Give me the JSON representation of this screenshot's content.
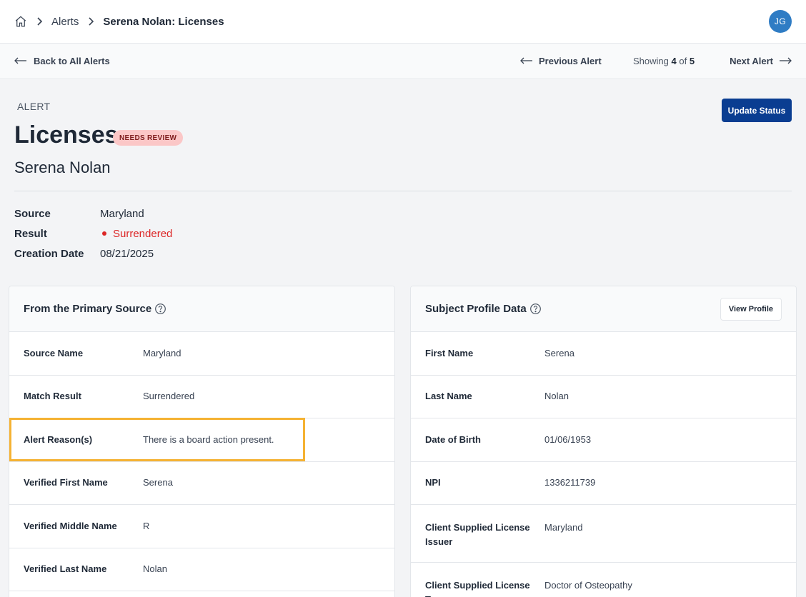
{
  "breadcrumb": {
    "home_icon": "home-icon",
    "items": [
      "Alerts",
      "Serena Nolan: Licenses"
    ]
  },
  "user": {
    "initials": "JG"
  },
  "subnav": {
    "back_label": "Back to All Alerts",
    "prev_label": "Previous Alert",
    "next_label": "Next Alert",
    "showing_prefix": "Showing",
    "current": "4",
    "of_word": "of",
    "total": "5"
  },
  "alert": {
    "eyebrow": "ALERT",
    "title": "Licenses",
    "badge": "NEEDS REVIEW",
    "subject": "Serena Nolan",
    "update_button": "Update Status",
    "meta": [
      {
        "key": "Source",
        "value": "Maryland"
      },
      {
        "key": "Result",
        "value": "Surrendered"
      },
      {
        "key": "Creation Date",
        "value": "08/21/2025"
      }
    ]
  },
  "primary_source": {
    "title": "From the Primary Source",
    "rows": [
      {
        "key": "Source Name",
        "value": "Maryland"
      },
      {
        "key": "Match Result",
        "value": "Surrendered"
      },
      {
        "key": "Alert Reason(s)",
        "value": "There is a board action present."
      },
      {
        "key": "Verified First Name",
        "value": "Serena"
      },
      {
        "key": "Verified Middle Name",
        "value": "R"
      },
      {
        "key": "Verified Last Name",
        "value": "Nolan"
      }
    ]
  },
  "subject_profile": {
    "title": "Subject Profile Data",
    "view_button": "View Profile",
    "rows": [
      {
        "key": "First Name",
        "value": "Serena"
      },
      {
        "key": "Last Name",
        "value": "Nolan"
      },
      {
        "key": "Date of Birth",
        "value": "01/06/1953"
      },
      {
        "key": "NPI",
        "value": "1336211739"
      },
      {
        "key": "Client Supplied License Issuer",
        "value": "Maryland"
      },
      {
        "key": "Client Supplied License Type",
        "value": "Doctor of Osteopathy"
      }
    ]
  },
  "colors": {
    "accent": "#0a3d91",
    "danger": "#dc2626",
    "highlight": "#f5b233",
    "badge_bg": "#fbc7c7"
  }
}
